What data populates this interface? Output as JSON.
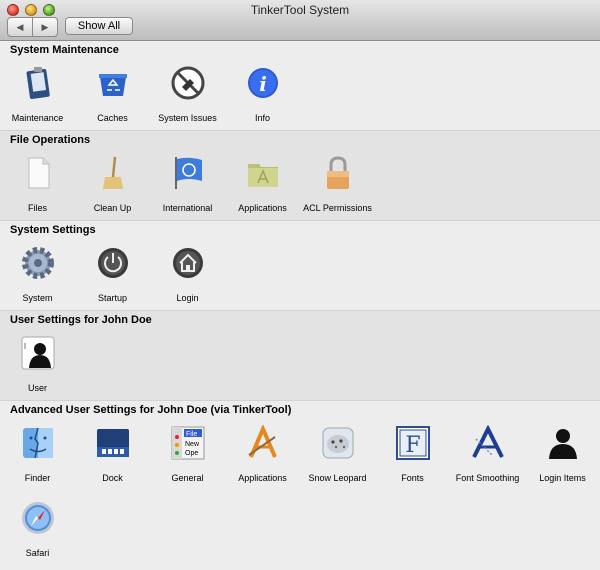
{
  "window": {
    "title": "TinkerTool System"
  },
  "toolbar": {
    "back": "◀",
    "forward": "▶",
    "show_all": "Show All"
  },
  "sections": [
    {
      "title": "System Maintenance",
      "items": [
        {
          "label": "Maintenance",
          "icon": "clipboard-icon"
        },
        {
          "label": "Caches",
          "icon": "recycle-bin-icon"
        },
        {
          "label": "System Issues",
          "icon": "prohibited-icon"
        },
        {
          "label": "Info",
          "icon": "info-icon"
        }
      ]
    },
    {
      "title": "File Operations",
      "items": [
        {
          "label": "Files",
          "icon": "document-icon"
        },
        {
          "label": "Clean Up",
          "icon": "broom-icon"
        },
        {
          "label": "International",
          "icon": "un-flag-icon"
        },
        {
          "label": "Applications",
          "icon": "applications-folder-icon"
        },
        {
          "label": "ACL Permissions",
          "icon": "padlock-icon"
        }
      ]
    },
    {
      "title": "System Settings",
      "items": [
        {
          "label": "System",
          "icon": "gear-icon"
        },
        {
          "label": "Startup",
          "icon": "power-icon"
        },
        {
          "label": "Login",
          "icon": "home-icon"
        }
      ]
    },
    {
      "title": "User Settings for John Doe",
      "items": [
        {
          "label": "User",
          "icon": "user-silhouette-icon"
        }
      ]
    },
    {
      "title": "Advanced User Settings for John Doe (via TinkerTool)",
      "items": [
        {
          "label": "Finder",
          "icon": "finder-icon"
        },
        {
          "label": "Dock",
          "icon": "dock-icon"
        },
        {
          "label": "General",
          "icon": "general-menu-icon"
        },
        {
          "label": "Applications",
          "icon": "applications-a-icon"
        },
        {
          "label": "Snow Leopard",
          "icon": "snow-leopard-icon"
        },
        {
          "label": "Fonts",
          "icon": "fonts-icon"
        },
        {
          "label": "Font Smoothing",
          "icon": "font-smoothing-icon"
        },
        {
          "label": "Login Items",
          "icon": "login-items-icon"
        },
        {
          "label": "Safari",
          "icon": "safari-compass-icon"
        }
      ]
    }
  ],
  "general_icon_text": {
    "line1": "File",
    "line2": "New",
    "line3": "Ope"
  }
}
